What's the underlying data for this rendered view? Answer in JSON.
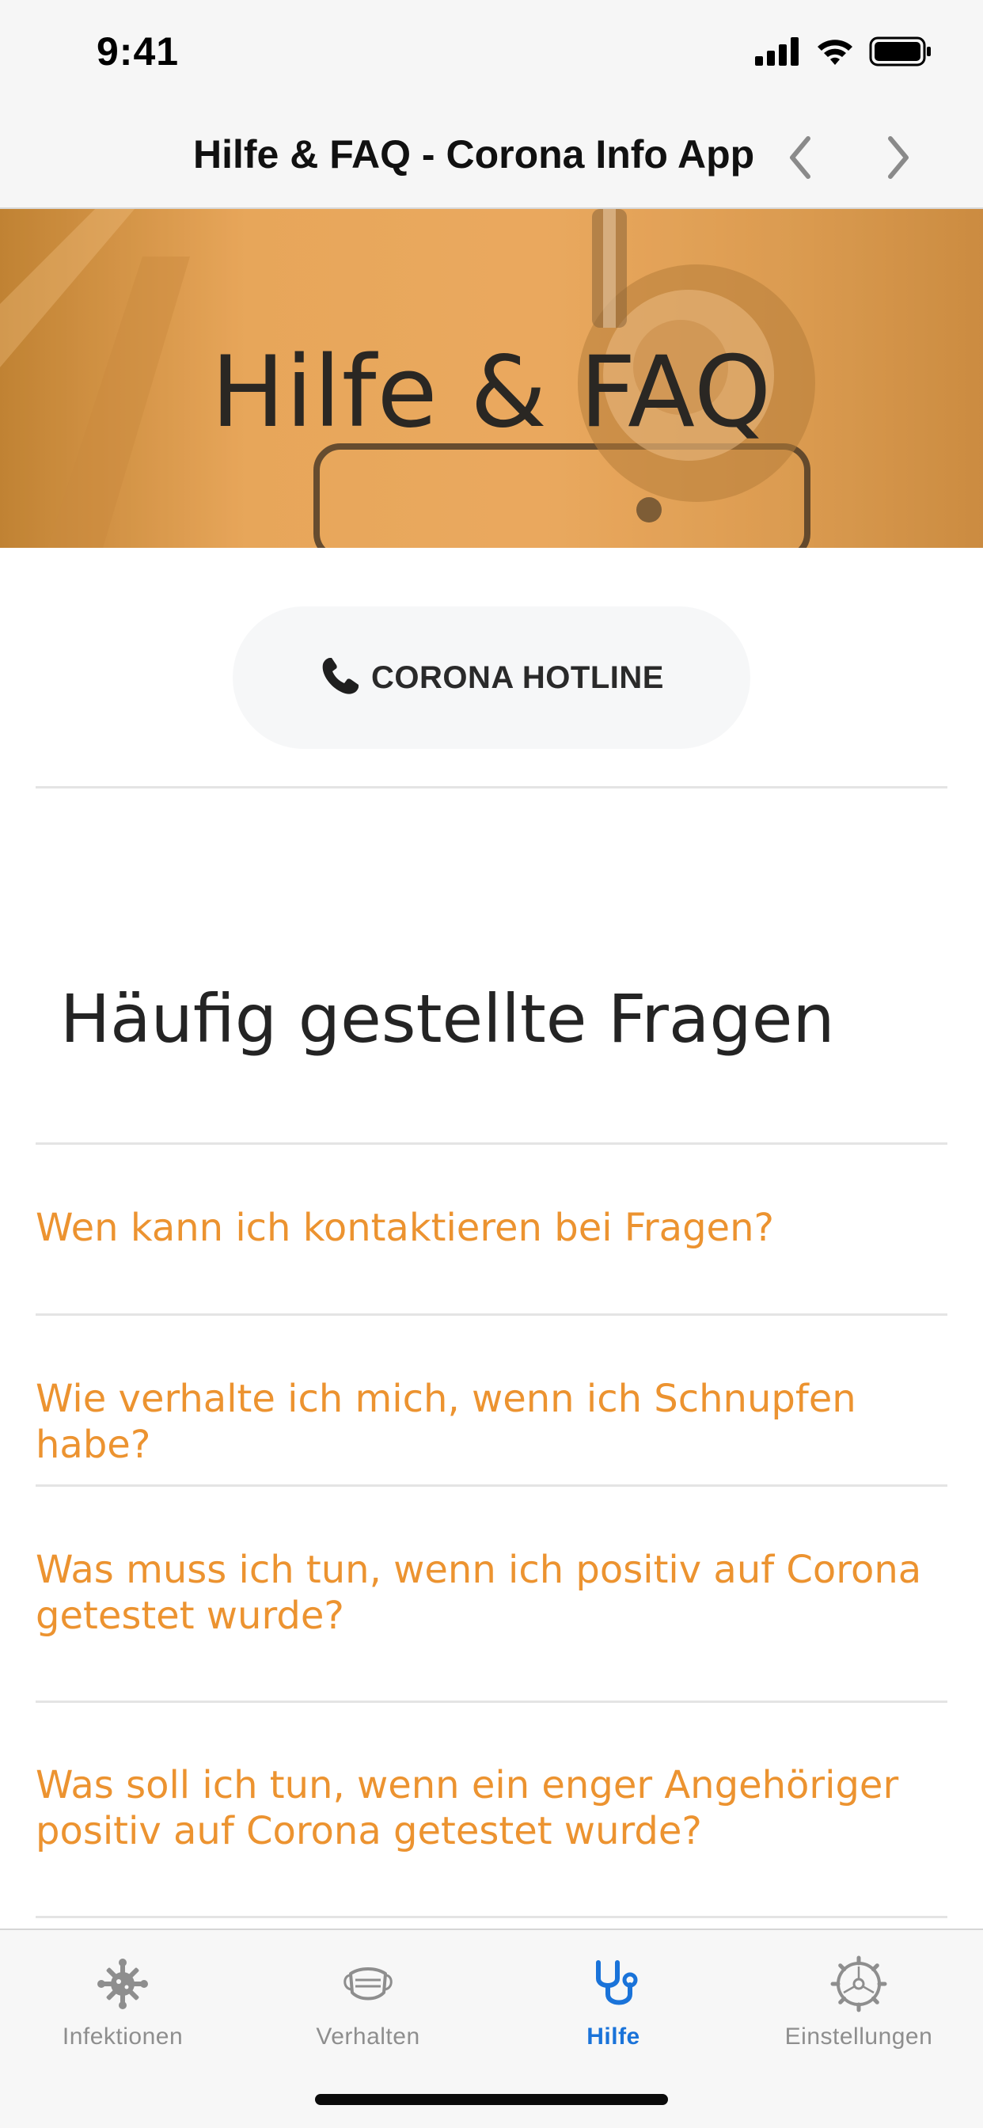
{
  "status_bar": {
    "time": "9:41"
  },
  "nav": {
    "title": "Hilfe & FAQ - Corona Info App"
  },
  "hero": {
    "title": "Hilfe & FAQ"
  },
  "hotline": {
    "icon": "phone-icon",
    "label": "CORONA HOTLINE"
  },
  "faq": {
    "heading": "Häufig gestellte Fragen",
    "items": [
      {
        "line1": "Wen kann ich kontaktieren bei Fragen?",
        "line2": ""
      },
      {
        "line1": "Wie verhalte ich mich, wenn ich Schnupfen habe?",
        "line2": ""
      },
      {
        "line1": "Was muss ich tun, wenn ich positiv auf Corona",
        "line2": "getestet wurde?"
      },
      {
        "line1": "Was soll ich tun, wenn ein enger Angehöriger",
        "line2": "positiv auf Corona getestet wurde?"
      }
    ],
    "color": "#ec9330"
  },
  "tabs": [
    {
      "label": "Infektionen",
      "icon": "virus-icon",
      "active": false
    },
    {
      "label": "Verhalten",
      "icon": "mask-icon",
      "active": false
    },
    {
      "label": "Hilfe",
      "icon": "stethoscope-icon",
      "active": true
    },
    {
      "label": "Einstellungen",
      "icon": "gear-icon",
      "active": false
    }
  ],
  "colors": {
    "accent": "#1a73d9",
    "hero": "#e7a65a",
    "faq_link": "#ec9330"
  }
}
